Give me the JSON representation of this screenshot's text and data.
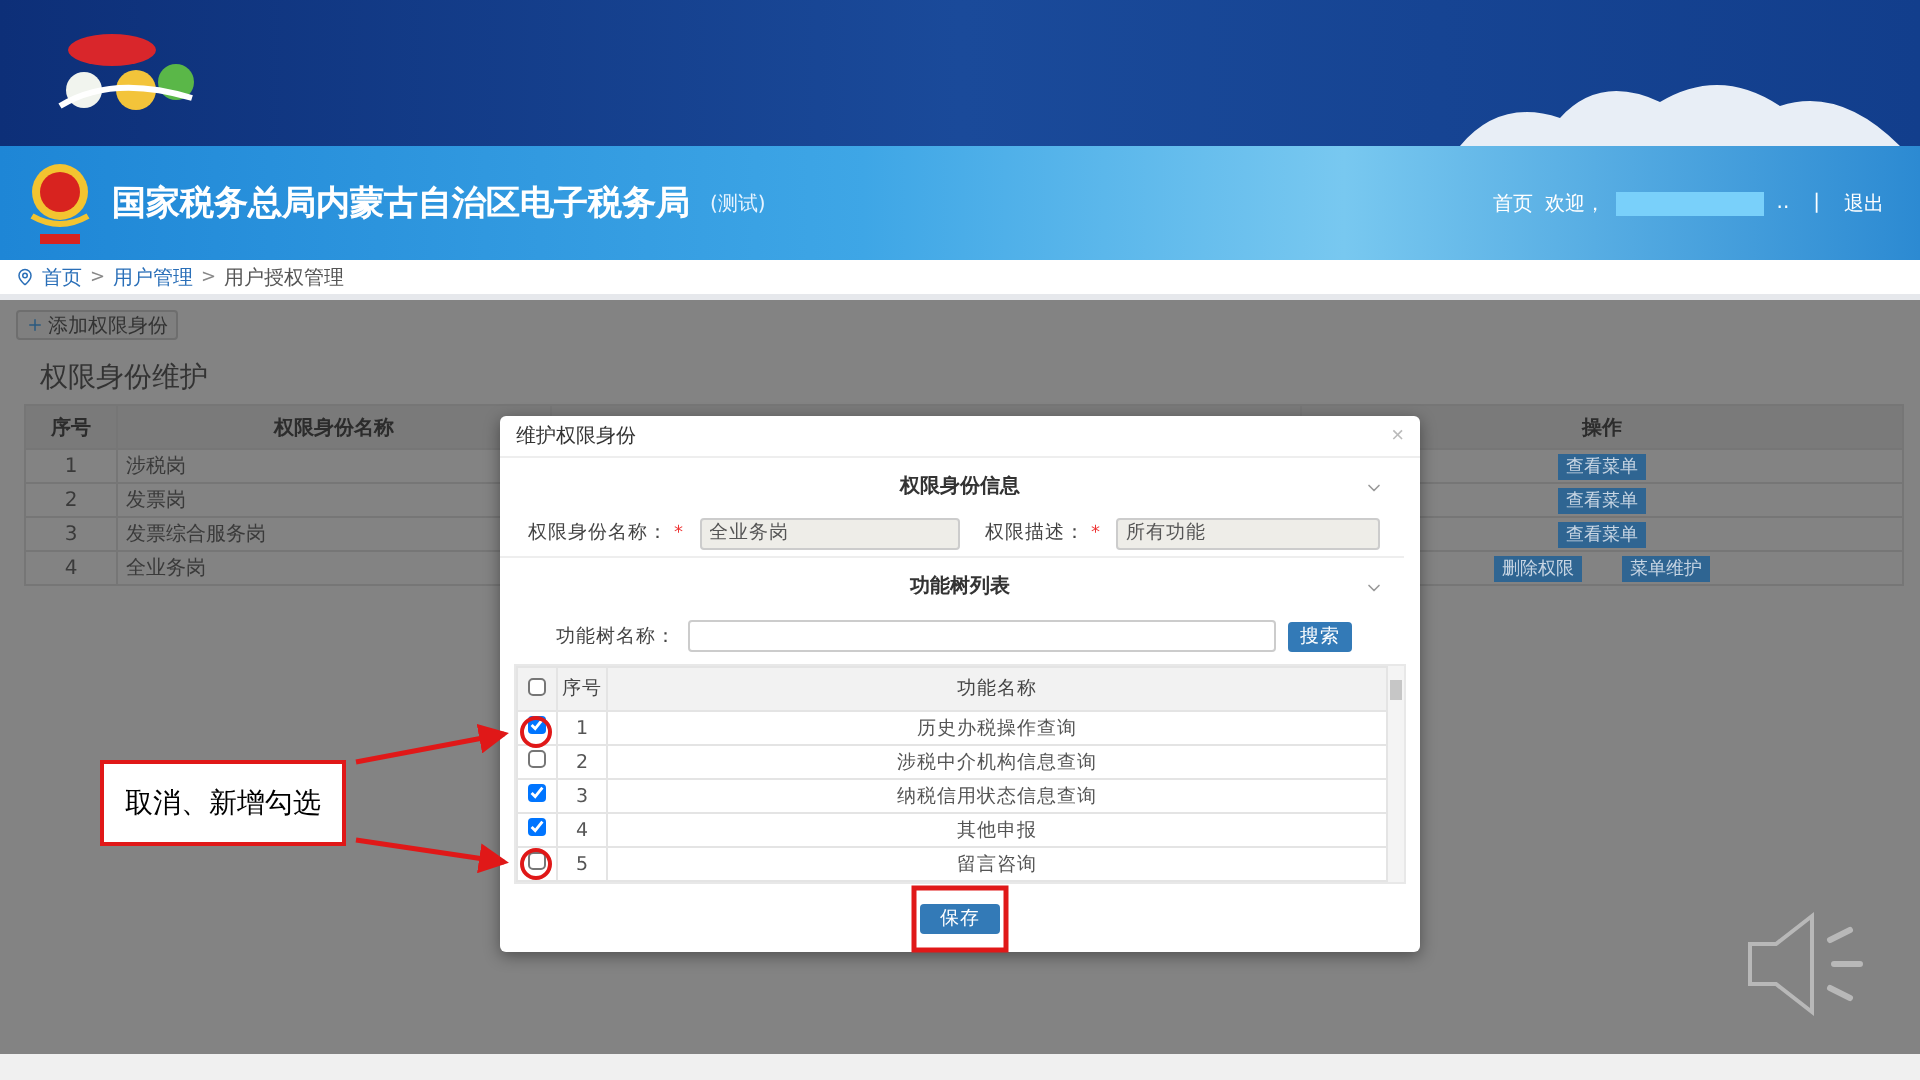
{
  "header": {
    "title": "国家税务总局内蒙古自治区电子税务局",
    "title_suffix": "(测试)",
    "home_link": "首页",
    "welcome": "欢迎，",
    "user_suffix": "..",
    "separator": "|",
    "logout": "退出"
  },
  "breadcrumb": {
    "items": [
      "首页",
      "用户管理",
      "用户授权管理"
    ],
    "separators": [
      ">",
      ">"
    ]
  },
  "toolbar": {
    "add_button": "添加权限身份"
  },
  "page_title": "权限身份维护",
  "role_table": {
    "columns": [
      "序号",
      "权限身份名称",
      "操作"
    ],
    "rows": [
      {
        "index": "1",
        "name": "涉税岗",
        "actions": [
          "查看菜单"
        ]
      },
      {
        "index": "2",
        "name": "发票岗",
        "actions": [
          "查看菜单"
        ]
      },
      {
        "index": "3",
        "name": "发票综合服务岗",
        "actions": [
          "查看菜单"
        ]
      },
      {
        "index": "4",
        "name": "全业务岗",
        "actions": [
          "删除权限",
          "菜单维护"
        ]
      }
    ]
  },
  "dialog": {
    "title": "维护权限身份",
    "close": "×",
    "info_title": "权限身份信息",
    "fields": [
      {
        "label": "权限身份名称：",
        "required_mark": "*",
        "value": "全业务岗"
      },
      {
        "label": "权限描述：",
        "required_mark": "*",
        "value": "所有功能"
      }
    ],
    "tree_title": "功能树列表",
    "search_label": "功能树名称：",
    "search_button": "搜索",
    "table": {
      "header_checked": false,
      "columns": [
        "序号",
        "功能名称"
      ],
      "rows": [
        {
          "index": "1",
          "name": "历史办税操作查询",
          "checked": true
        },
        {
          "index": "2",
          "name": "涉税中介机构信息查询",
          "checked": false
        },
        {
          "index": "3",
          "name": "纳税信用状态信息查询",
          "checked": true
        },
        {
          "index": "4",
          "name": "其他申报",
          "checked": true
        },
        {
          "index": "5",
          "name": "留言咨询",
          "checked": false
        }
      ]
    },
    "save_button": "保存"
  },
  "annotation": {
    "callout": "取消、新增勾选"
  }
}
